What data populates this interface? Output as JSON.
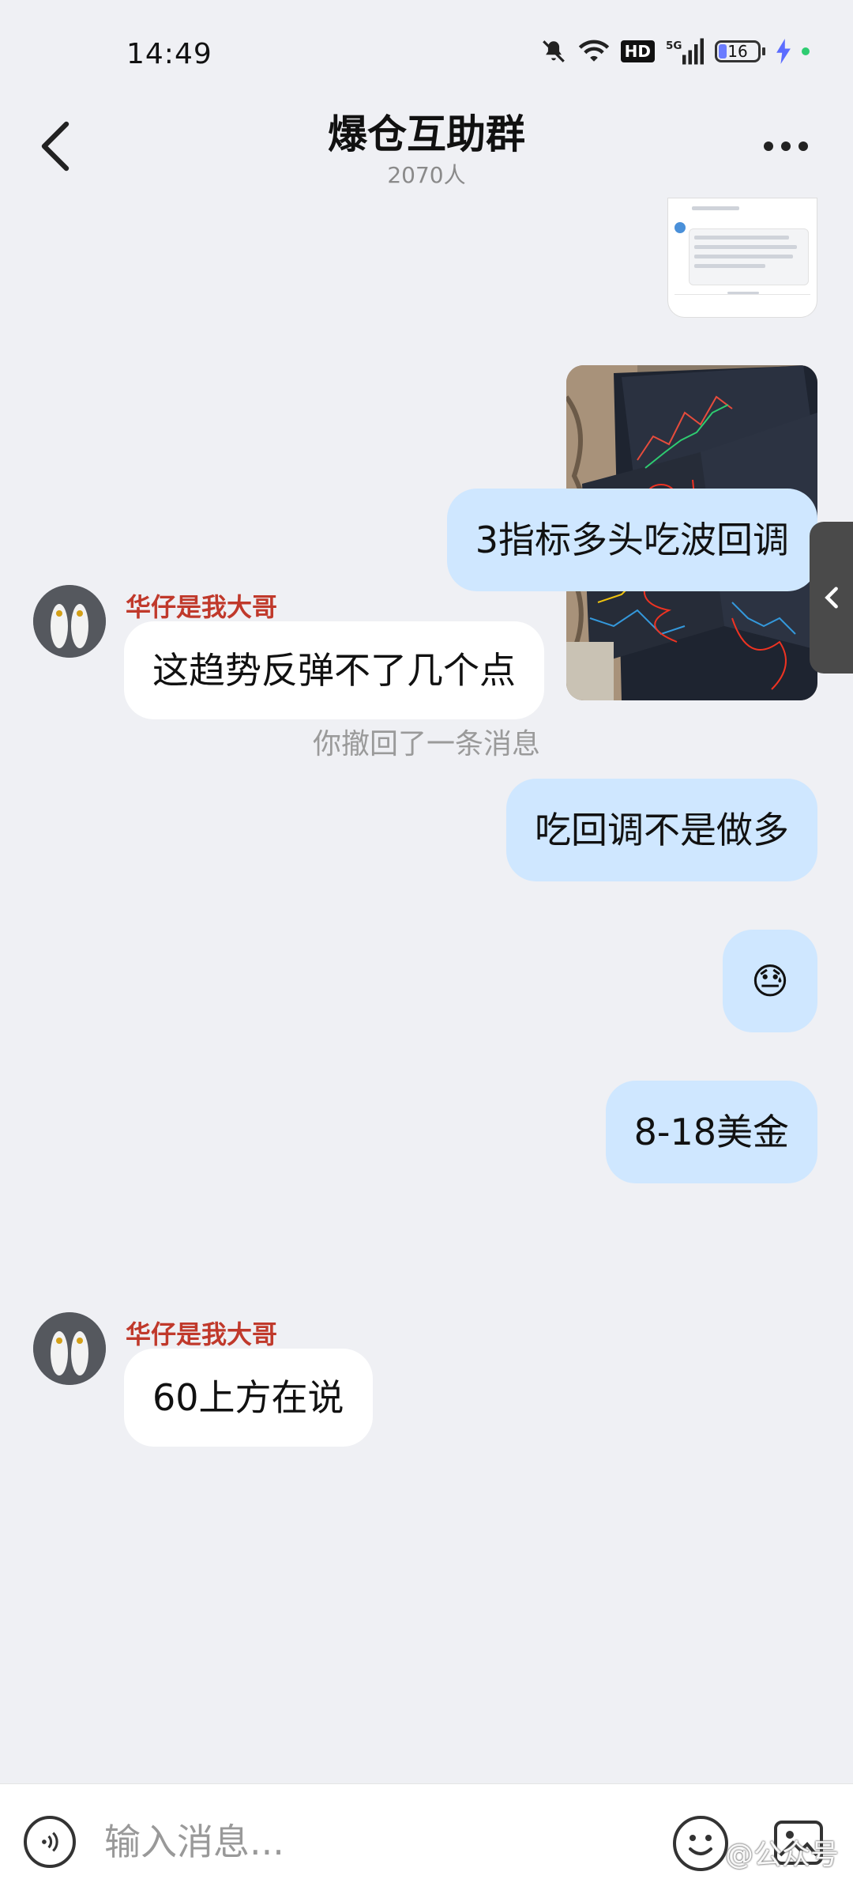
{
  "status_bar": {
    "time": "14:49",
    "network": "5G",
    "hd": "HD",
    "battery": "16"
  },
  "header": {
    "title": "爆仓互助群",
    "member_count": "2070人"
  },
  "messages": {
    "my_text_1": "3指标多头吃波回调",
    "other_1": {
      "sender": "华仔是我大哥",
      "text": "这趋势反弹不了几个点"
    },
    "system_1": "你撤回了一条消息",
    "my_text_2": "吃回调不是做多",
    "my_emoji": "😓",
    "my_text_3": "8-18美金",
    "other_2": {
      "sender": "华仔是我大哥",
      "text": "60上方在说"
    }
  },
  "input": {
    "placeholder": "输入消息..."
  },
  "watermark": "@公众号",
  "colors": {
    "background": "#eff0f4",
    "my_bubble": "#cfe7ff",
    "other_bubble": "#ffffff",
    "sender_name": "#c0392b"
  },
  "icons": [
    "back-icon",
    "more-icon",
    "mute-icon",
    "wifi-icon",
    "signal-icon",
    "battery-icon",
    "voice-icon",
    "emoji-icon",
    "image-icon",
    "chevron-left-icon"
  ]
}
